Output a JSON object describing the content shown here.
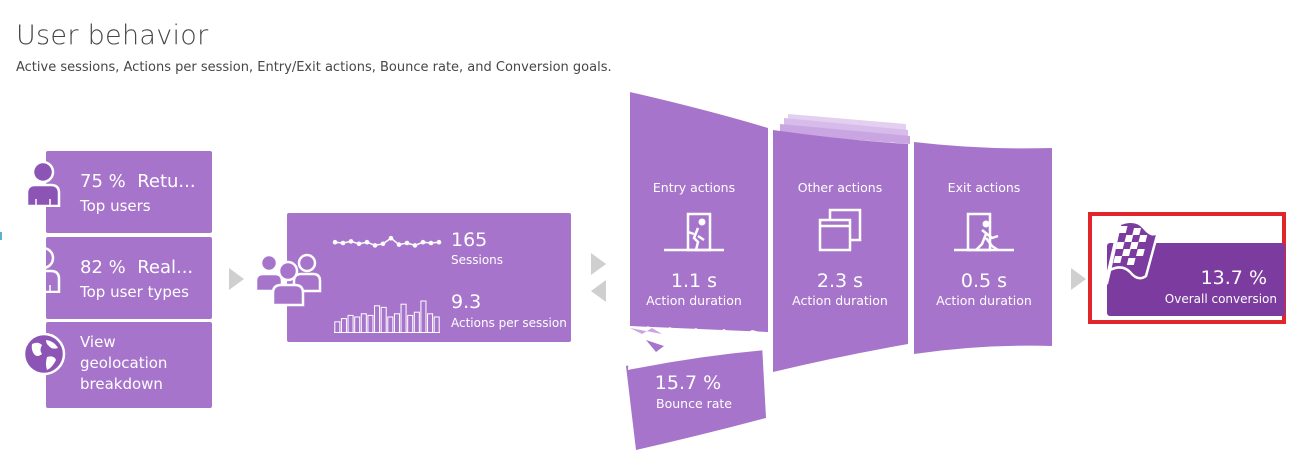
{
  "header": {
    "title": "User behavior",
    "subtitle": "Active sessions, Actions per session, Entry/Exit actions, Bounce rate, and Conversion goals."
  },
  "colors": {
    "tile": "#a774cb",
    "tile_dark": "#8c54b4",
    "conversion": "#7c3c9f",
    "highlight": "#e0262b",
    "arrow": "#cfcfcf"
  },
  "side_tiles": [
    {
      "value": "75 %",
      "name": "Retu...",
      "label": "Top users",
      "icon": "returning-user-icon"
    },
    {
      "value": "82 %",
      "name": "Real...",
      "label": "Top user types",
      "icon": "real-user-icon"
    },
    {
      "label_lines": [
        "View",
        "geolocation",
        "breakdown"
      ],
      "icon": "globe-icon"
    }
  ],
  "sessions": {
    "icon": "users-group-icon",
    "sessions_value": "165",
    "sessions_label": "Sessions",
    "actions_value": "9.3",
    "actions_label": "Actions per session",
    "sparkline": [
      0.55,
      0.5,
      0.6,
      0.45,
      0.55,
      0.35,
      0.45,
      0.8,
      0.4,
      0.5,
      0.35,
      0.55,
      0.5,
      0.55
    ],
    "bars": [
      0.35,
      0.45,
      0.55,
      0.5,
      0.6,
      0.55,
      0.85,
      0.8,
      0.5,
      0.6,
      0.9,
      0.55,
      0.65,
      1.0,
      0.6,
      0.5
    ]
  },
  "funnel": {
    "entry": {
      "label": "Entry actions",
      "value": "1.1 s",
      "sub": "Action duration",
      "icon": "entry-door-icon"
    },
    "other": {
      "label": "Other actions",
      "value": "2.3 s",
      "sub": "Action duration",
      "icon": "windows-stack-icon"
    },
    "exit": {
      "label": "Exit actions",
      "value": "0.5 s",
      "sub": "Action duration",
      "icon": "exit-door-icon"
    },
    "bounce": {
      "value": "15.7 %",
      "label": "Bounce rate"
    }
  },
  "conversion": {
    "value": "13.7 %",
    "label": "Overall conversion",
    "icon": "checkered-flag-icon"
  }
}
